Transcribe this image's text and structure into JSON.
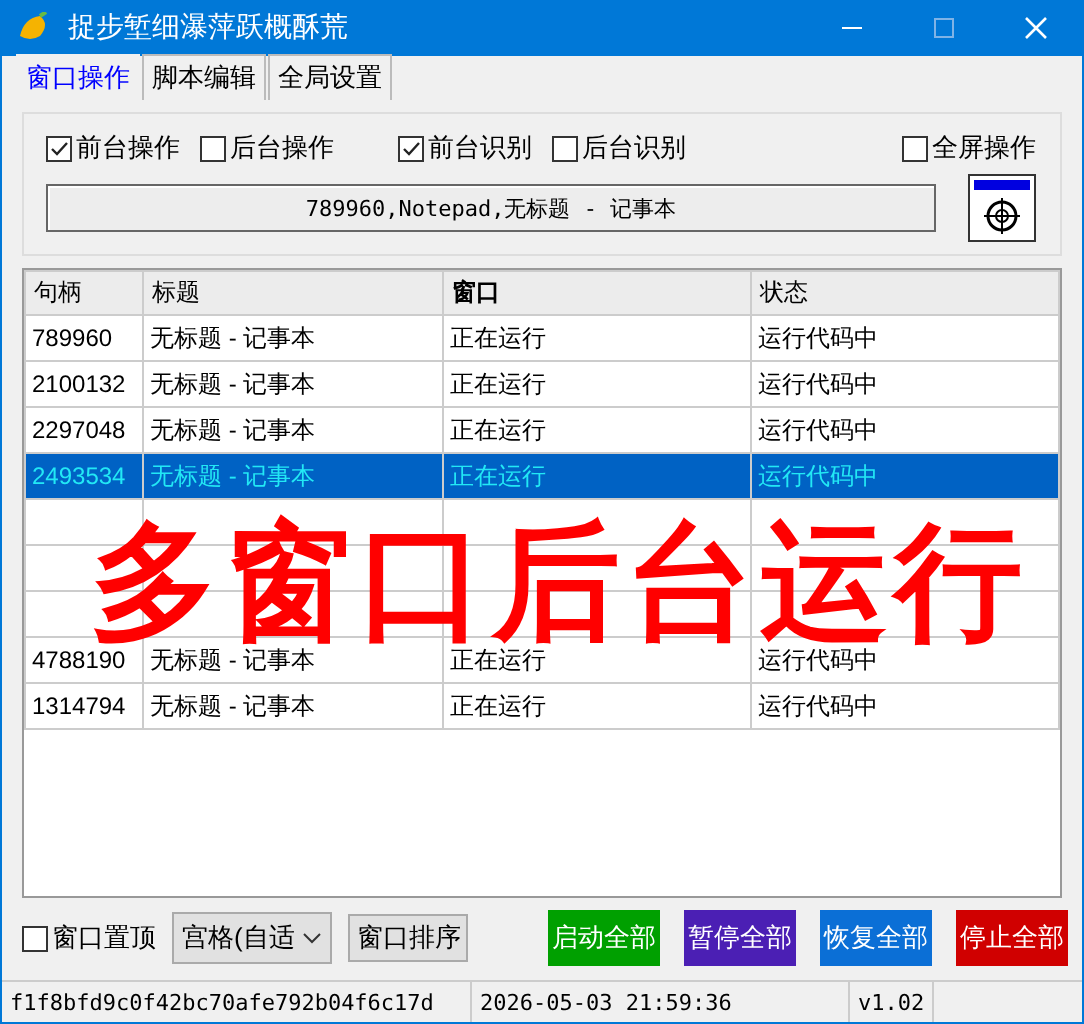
{
  "window": {
    "title": "捉步堑细瀑萍跃概酥荒"
  },
  "tabs": [
    {
      "label": "窗口操作",
      "selected": true
    },
    {
      "label": "脚本编辑",
      "selected": false
    },
    {
      "label": "全局设置",
      "selected": false
    }
  ],
  "options": [
    {
      "label": "前台操作",
      "checked": true
    },
    {
      "label": "后台操作",
      "checked": false
    },
    {
      "label": "前台识别",
      "checked": true
    },
    {
      "label": "后台识别",
      "checked": false
    },
    {
      "label": "全屏操作",
      "checked": false
    }
  ],
  "target_window": "789960,Notepad,无标题 - 记事本",
  "table": {
    "columns": [
      {
        "label": "句柄",
        "bold": false
      },
      {
        "label": "标题",
        "bold": false
      },
      {
        "label": "窗口",
        "bold": true
      },
      {
        "label": "状态",
        "bold": false
      }
    ],
    "rows": [
      {
        "cells": [
          "789960",
          "无标题 - 记事本",
          "正在运行",
          "运行代码中"
        ],
        "selected": false
      },
      {
        "cells": [
          "2100132",
          "无标题 - 记事本",
          "正在运行",
          "运行代码中"
        ],
        "selected": false
      },
      {
        "cells": [
          "2297048",
          "无标题 - 记事本",
          "正在运行",
          "运行代码中"
        ],
        "selected": false
      },
      {
        "cells": [
          "2493534",
          "无标题 - 记事本",
          "正在运行",
          "运行代码中"
        ],
        "selected": true
      },
      {
        "selected": false
      },
      {
        "selected": false
      },
      {
        "selected": false
      },
      {
        "cells": [
          "4788190",
          "无标题 - 记事本",
          "正在运行",
          "运行代码中"
        ],
        "selected": false
      },
      {
        "cells": [
          "1314794",
          "无标题 - 记事本",
          "正在运行",
          "运行代码中"
        ],
        "selected": false
      }
    ]
  },
  "overlay_banner": "多窗口后台运行",
  "pin_on_top": {
    "label": "窗口置顶",
    "checked": false
  },
  "layout_select": {
    "value": "宫格(自适"
  },
  "arrange_button": "窗口排序",
  "actions": [
    {
      "label": "启动全部",
      "color": "#00a000"
    },
    {
      "label": "暂停全部",
      "color": "#4b1fb4"
    },
    {
      "label": "恢复全部",
      "color": "#0b6fd6"
    },
    {
      "label": "停止全部",
      "color": "#d00000"
    }
  ],
  "status_bar": [
    "f1f8bfd9c0f42bc70afe792b04f6c17d",
    "2026-05-03 21:59:36",
    "v1.02"
  ]
}
